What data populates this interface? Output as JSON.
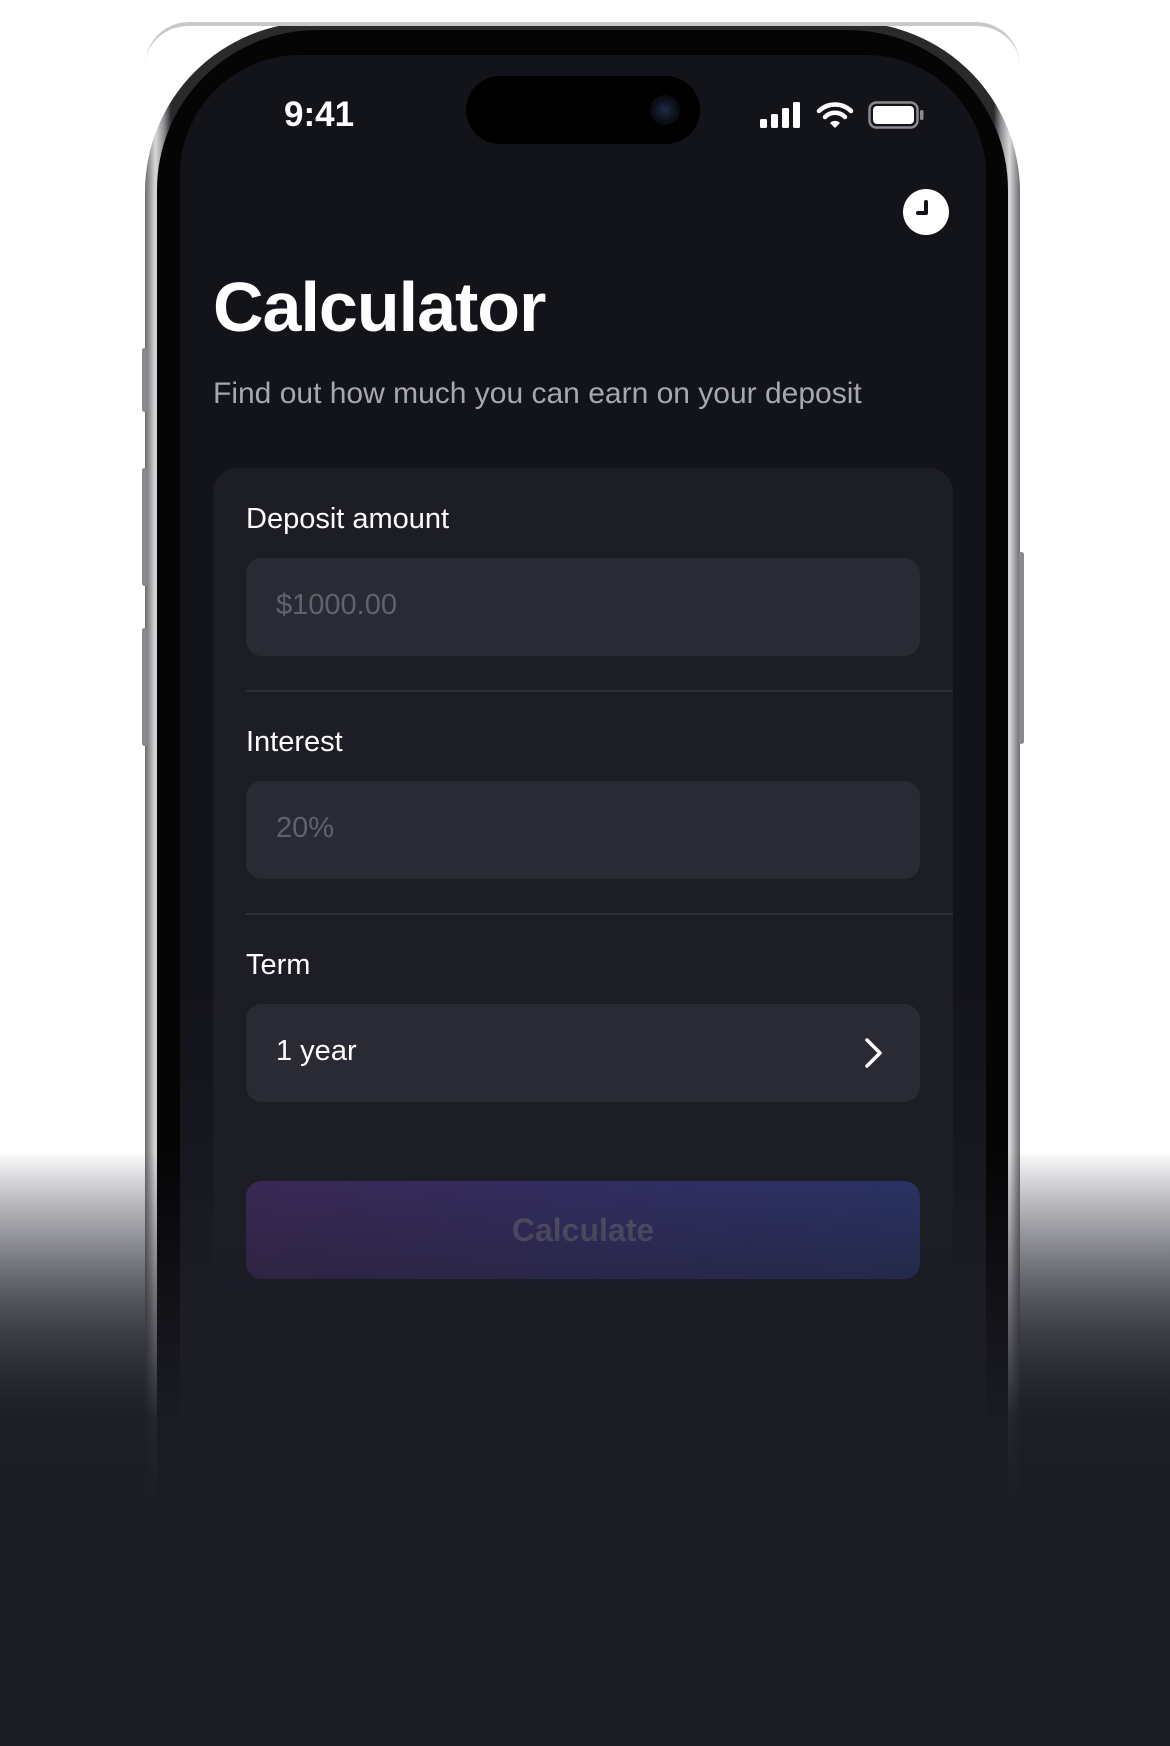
{
  "status_bar": {
    "time": "9:41",
    "icons": [
      "cellular-signal-icon",
      "wifi-icon",
      "battery-icon"
    ]
  },
  "header": {
    "history_icon": "clock-icon",
    "title": "Calculator",
    "subtitle": "Find out how much you can earn on your deposit"
  },
  "form": {
    "deposit": {
      "label": "Deposit amount",
      "placeholder": "$1000.00"
    },
    "interest": {
      "label": "Interest",
      "placeholder": "20%"
    },
    "term": {
      "label": "Term",
      "value": "1 year",
      "icon": "chevron-right-icon"
    },
    "calculate_label": "Calculate"
  },
  "colors": {
    "screen_bg": "#13131a",
    "card_bg": "#1d1d26",
    "field_bg": "#2a2a34",
    "button_gradient_start": "#3e2a5c",
    "button_gradient_end": "#2b356b"
  }
}
